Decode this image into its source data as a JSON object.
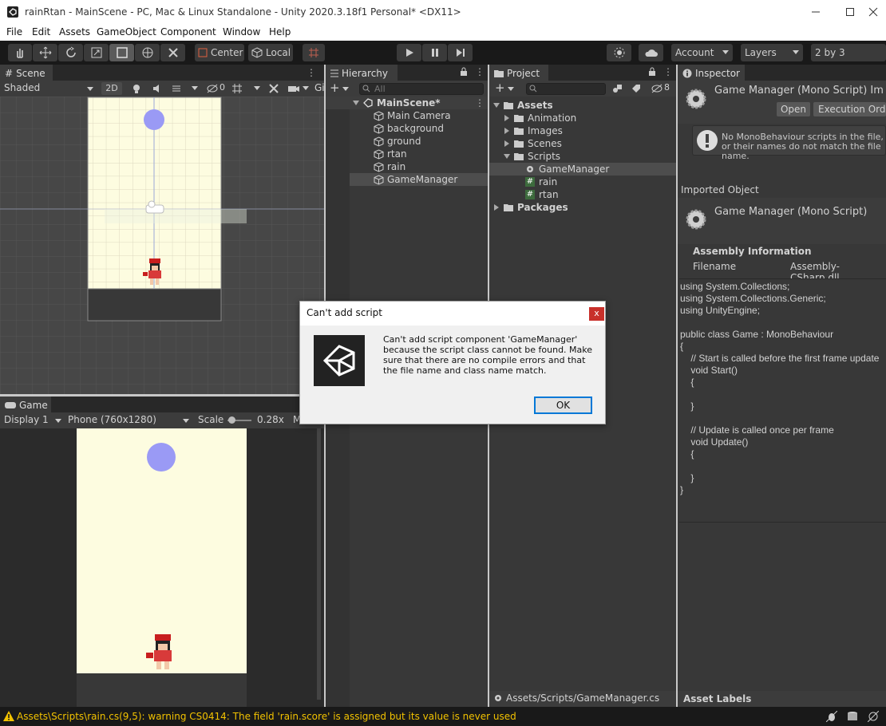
{
  "titlebar": {
    "title": "rainRtan - MainScene - PC, Mac & Linux Standalone - Unity 2020.3.18f1 Personal* <DX11>"
  },
  "menu": [
    "File",
    "Edit",
    "Assets",
    "GameObject",
    "Component",
    "Window",
    "Help"
  ],
  "toolbar": {
    "pivot": "Center",
    "space": "Local",
    "account": "Account",
    "layers": "Layers",
    "layout": "2 by 3"
  },
  "scene": {
    "tab": "Scene",
    "shading": "Shaded",
    "mode2d": "2D",
    "hidden_count": "0",
    "gizmos": "Gi"
  },
  "game": {
    "tab": "Game",
    "display": "Display 1",
    "resolution": "Phone (760x1280)",
    "scale_label": "Scale",
    "scale_value": "0.28x",
    "maximize": "M"
  },
  "hierarchy": {
    "tab": "Hierarchy",
    "search_placeholder": "All",
    "scene": "MainScene*",
    "items": [
      "Main Camera",
      "background",
      "ground",
      "rtan",
      "rain",
      "GameManager"
    ]
  },
  "project": {
    "tab": "Project",
    "hidden_count": "8",
    "assets": "Assets",
    "folders": [
      "Animation",
      "Images",
      "Scenes",
      "Scripts"
    ],
    "scripts": [
      "GameManager",
      "rain",
      "rtan"
    ],
    "packages": "Packages",
    "footer_path": "Assets/Scripts/GameManager.cs"
  },
  "inspector": {
    "tab": "Inspector",
    "header_title": "Game Manager (Mono Script) Im",
    "open_button": "Open",
    "exec_order_button": "Execution Orde",
    "warning": "No MonoBehaviour scripts in the file, or their names do not match the file name.",
    "imported_label": "Imported Object",
    "imported_title": "Game Manager (Mono Script)",
    "assembly_label": "Assembly Information",
    "filename_label": "Filename",
    "filename_value": "Assembly-CSharp.dll",
    "code": "using System.Collections;\nusing System.Collections.Generic;\nusing UnityEngine;\n\npublic class Game : MonoBehaviour\n{\n    // Start is called before the first frame update\n    void Start()\n    {\n\n    }\n\n    // Update is called once per frame\n    void Update()\n    {\n\n    }\n}",
    "asset_labels": "Asset Labels"
  },
  "dialog": {
    "title": "Can't add script",
    "close": "x",
    "message": "Can't add script component 'GameManager' because the script class cannot be found. Make sure that there are no compile errors and that the file name and class name match.",
    "ok": "OK"
  },
  "statusbar": {
    "message": "Assets\\Scripts\\rain.cs(9,5): warning CS0414: The field 'rain.score' is assigned but its value is never used"
  }
}
